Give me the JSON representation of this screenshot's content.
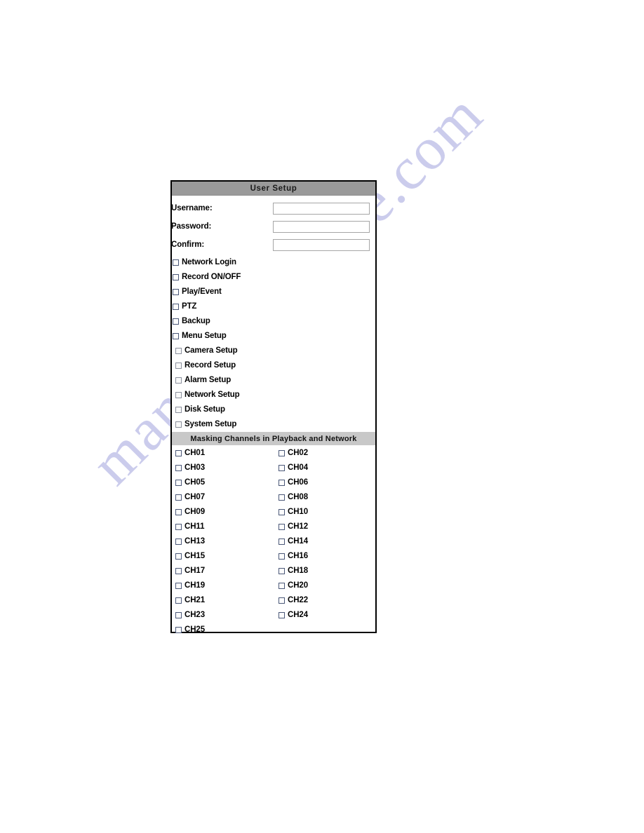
{
  "watermark": {
    "text": "manualsarchive.com"
  },
  "panel": {
    "title": "User Setup",
    "credentials": [
      {
        "label": "Username:",
        "value": "",
        "placeholder": ""
      },
      {
        "label": "Password:",
        "value": "",
        "placeholder": ""
      },
      {
        "label": "Confirm:",
        "value": "",
        "placeholder": ""
      }
    ],
    "permissions": [
      {
        "label": "Network Login",
        "checked": false,
        "indented": false
      },
      {
        "label": "Record ON/OFF",
        "checked": false,
        "indented": false
      },
      {
        "label": "Play/Event",
        "checked": false,
        "indented": false
      },
      {
        "label": "PTZ",
        "checked": false,
        "indented": false
      },
      {
        "label": "Backup",
        "checked": false,
        "indented": false
      },
      {
        "label": "Menu Setup",
        "checked": false,
        "indented": false
      },
      {
        "label": "Camera Setup",
        "checked": false,
        "indented": true
      },
      {
        "label": "Record Setup",
        "checked": false,
        "indented": true
      },
      {
        "label": "Alarm Setup",
        "checked": false,
        "indented": true
      },
      {
        "label": "Network Setup",
        "checked": false,
        "indented": true
      },
      {
        "label": "Disk Setup",
        "checked": false,
        "indented": true
      },
      {
        "label": "System Setup",
        "checked": false,
        "indented": true
      }
    ],
    "masking": {
      "section_title": "Masking Channels in Playback and Network",
      "channels": [
        {
          "label": "CH01",
          "checked": false
        },
        {
          "label": "CH02",
          "checked": false
        },
        {
          "label": "CH03",
          "checked": false
        },
        {
          "label": "CH04",
          "checked": false
        },
        {
          "label": "CH05",
          "checked": false
        },
        {
          "label": "CH06",
          "checked": false
        },
        {
          "label": "CH07",
          "checked": false
        },
        {
          "label": "CH08",
          "checked": false
        },
        {
          "label": "CH09",
          "checked": false
        },
        {
          "label": "CH10",
          "checked": false
        },
        {
          "label": "CH11",
          "checked": false
        },
        {
          "label": "CH12",
          "checked": false
        },
        {
          "label": "CH13",
          "checked": false
        },
        {
          "label": "CH14",
          "checked": false
        },
        {
          "label": "CH15",
          "checked": false
        },
        {
          "label": "CH16",
          "checked": false
        },
        {
          "label": "CH17",
          "checked": false
        },
        {
          "label": "CH18",
          "checked": false
        },
        {
          "label": "CH19",
          "checked": false
        },
        {
          "label": "CH20",
          "checked": false
        },
        {
          "label": "CH21",
          "checked": false
        },
        {
          "label": "CH22",
          "checked": false
        },
        {
          "label": "CH23",
          "checked": false
        },
        {
          "label": "CH24",
          "checked": false
        },
        {
          "label": "CH25",
          "checked": false
        }
      ],
      "columns": 2
    }
  },
  "colors": {
    "title_bar": "#9a9a9a",
    "section_bar": "#c8c8c8",
    "panel_border": "#000000",
    "checkbox_border": "#4b5878",
    "input_border": "#a6a6a6",
    "watermark": "#c9caec"
  }
}
